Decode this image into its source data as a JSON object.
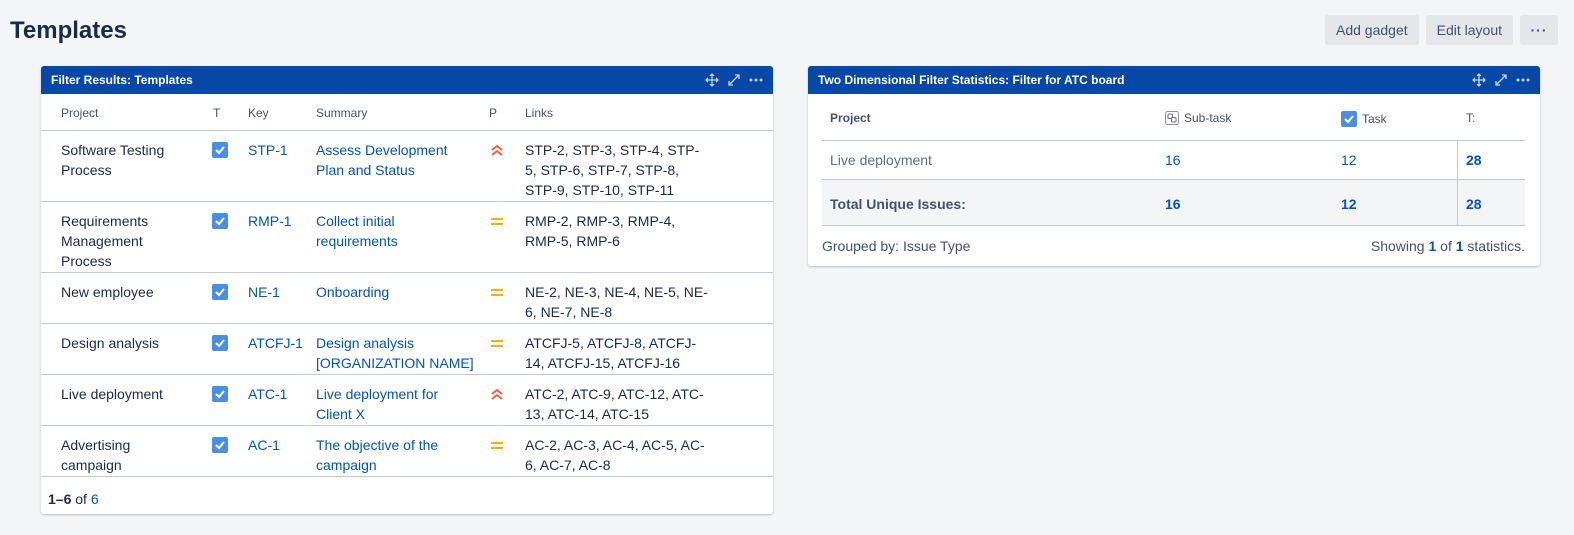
{
  "page": {
    "title": "Templates"
  },
  "toolbar": {
    "add_gadget": "Add gadget",
    "edit_layout": "Edit layout",
    "more": "···"
  },
  "filter_gadget": {
    "title": "Filter Results: Templates",
    "columns": {
      "project": "Project",
      "type": "T",
      "key": "Key",
      "summary": "Summary",
      "priority": "P",
      "links": "Links"
    },
    "rows": [
      {
        "project": "Software Testing Process",
        "key": "STP-1",
        "summary": "Assess Development Plan and Status",
        "priority": "high",
        "links": "STP-2, STP-3, STP-4, STP-5, STP-6, STP-7, STP-8, STP-9, STP-10, STP-11"
      },
      {
        "project": "Requirements Management Process",
        "key": "RMP-1",
        "summary": "Collect initial requirements",
        "priority": "medium",
        "links": "RMP-2, RMP-3, RMP-4, RMP-5, RMP-6"
      },
      {
        "project": "New employee",
        "key": "NE-1",
        "summary": "Onboarding",
        "priority": "medium",
        "links": "NE-2, NE-3, NE-4, NE-5, NE-6, NE-7, NE-8"
      },
      {
        "project": "Design analysis",
        "key": "ATCFJ-1",
        "summary": "Design analysis [ORGANIZATION NAME]",
        "priority": "medium",
        "links": "ATCFJ-5, ATCFJ-8, ATCFJ-14, ATCFJ-15, ATCFJ-16"
      },
      {
        "project": "Live deployment",
        "key": "ATC-1",
        "summary": "Live deployment for Client X",
        "priority": "high",
        "links": "ATC-2, ATC-9, ATC-12, ATC-13, ATC-14, ATC-15"
      },
      {
        "project": "Advertising campaign",
        "key": "AC-1",
        "summary": "The objective of the campaign",
        "priority": "medium",
        "links": "AC-2, AC-3, AC-4, AC-5, AC-6, AC-7, AC-8"
      }
    ],
    "pager": {
      "range": "1–6",
      "of": "of",
      "total": "6"
    }
  },
  "stats_gadget": {
    "title": "Two Dimensional Filter Statistics: Filter for ATC board",
    "columns": {
      "project": "Project",
      "subtask": "Sub-task",
      "task": "Task",
      "total": "T:"
    },
    "rows": [
      {
        "project": "Live deployment",
        "subtask": "16",
        "task": "12",
        "total": "28"
      }
    ],
    "totals": {
      "label": "Total Unique Issues:",
      "subtask": "16",
      "task": "12",
      "total": "28"
    },
    "grouped_by": "Grouped by: Issue Type",
    "showing": {
      "prefix": "Showing",
      "current": "1",
      "of": "of",
      "total": "1",
      "suffix": "statistics."
    }
  },
  "colors": {
    "header_blue": "#0747a6",
    "link": "#0052cc",
    "priority_high": "#ff5630",
    "priority_medium": "#ffab00",
    "checkbox": "#4a90e2"
  }
}
